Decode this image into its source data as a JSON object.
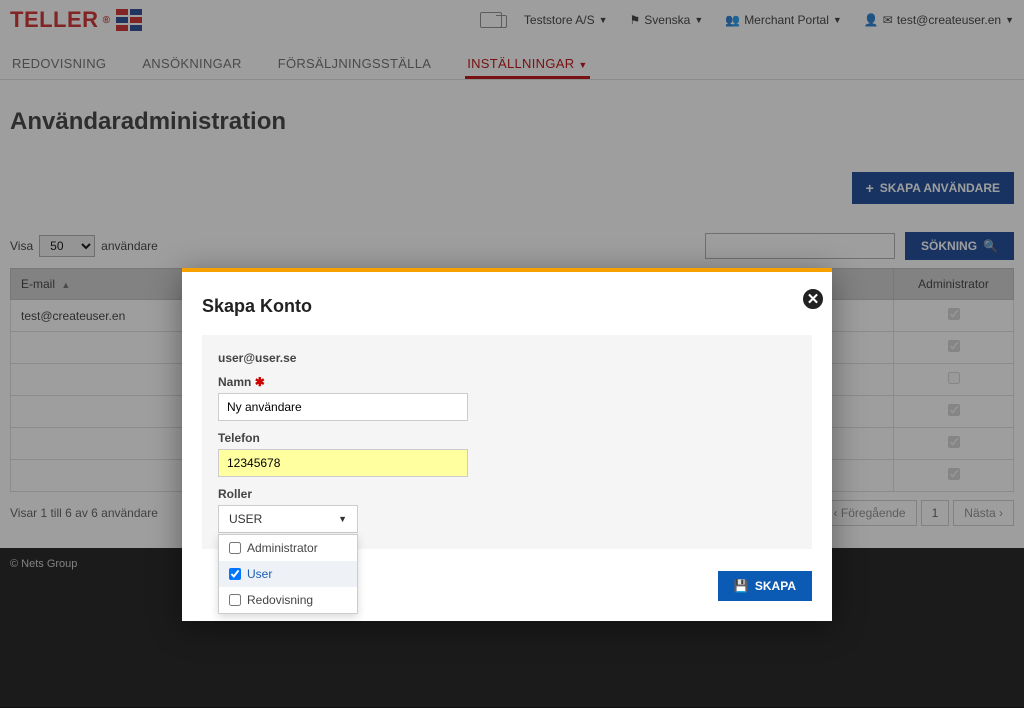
{
  "brand": {
    "name": "TELLER",
    "reg": "®"
  },
  "topbar": {
    "store": "Teststore A/S",
    "language": "Svenska",
    "portal": "Merchant Portal",
    "user": "test@createuser.en"
  },
  "nav": {
    "items": [
      {
        "label": "REDOVISNING",
        "active": false
      },
      {
        "label": "ANSÖKNINGAR",
        "active": false
      },
      {
        "label": "FÖRSÄLJNINGSSTÄLLA",
        "active": false
      },
      {
        "label": "INSTÄLLNINGAR",
        "active": true,
        "hasCaret": true
      }
    ]
  },
  "page": {
    "title": "Användaradministration",
    "create_user_btn": "SKAPA ANVÄNDARE",
    "show_label_pre": "Visa",
    "show_label_post": "användare",
    "page_size": "50",
    "search_btn": "SÖKNING",
    "table": {
      "col_email": "E-mail",
      "col_admin": "Administrator",
      "rows": [
        {
          "email": "test@createuser.en",
          "admin": true
        },
        {
          "email": "",
          "admin": true
        },
        {
          "email": "",
          "admin": false
        },
        {
          "email": "",
          "admin": true
        },
        {
          "email": "",
          "admin": true
        },
        {
          "email": "",
          "admin": true
        }
      ]
    },
    "info": "Visar 1 till 6 av 6 användare",
    "pager": {
      "prev": "Föregående",
      "page": "1",
      "next": "Nästa"
    }
  },
  "footer": {
    "copyright": "© Nets Group"
  },
  "modal": {
    "title": "Skapa Konto",
    "email": "user@user.se",
    "name_label": "Namn",
    "name_value": "Ny användare",
    "phone_label": "Telefon",
    "phone_value": "12345678",
    "roles_label": "Roller",
    "selected_role": "USER",
    "role_options": [
      {
        "label": "Administrator",
        "checked": false
      },
      {
        "label": "User",
        "checked": true
      },
      {
        "label": "Redovisning",
        "checked": false
      }
    ],
    "create_btn": "SKAPA"
  }
}
